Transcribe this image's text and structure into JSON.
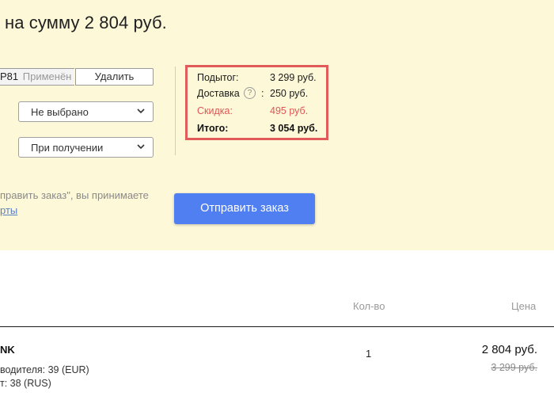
{
  "order": {
    "heading": "на сумму 2 804 руб."
  },
  "promo": {
    "code": "P81",
    "status": "Применён",
    "remove_label": "Удалить"
  },
  "delivery_select": {
    "value": "Не выбрано"
  },
  "payment_select": {
    "value": "При получении"
  },
  "summary": {
    "subtotal_label": "Подытог:",
    "subtotal_value": "3 299 руб.",
    "shipping_label": "Доставка",
    "shipping_help": "?",
    "shipping_colon": ":",
    "shipping_value": "250 руб.",
    "discount_label": "Скидка:",
    "discount_value": "495 руб.",
    "total_label": "Итого:",
    "total_value": "3 054 руб."
  },
  "terms": {
    "line1": "править заказ\", вы принимаете",
    "link": "рты"
  },
  "submit_label": "Отправить заказ",
  "table": {
    "headers": {
      "qty": "Кол-во",
      "price": "Цена"
    },
    "rows": [
      {
        "name": "NK",
        "attr1": "водителя: 39 (EUR)",
        "attr2": "т: 38 (RUS)",
        "qty": "1",
        "price": "2 804 руб.",
        "old_price": "3 299 руб."
      }
    ]
  },
  "colors": {
    "panel_bg": "#fdf8d8",
    "accent_blue": "#4f7ff0",
    "highlight_red": "#e25b5b",
    "discount_red": "#e05656"
  }
}
